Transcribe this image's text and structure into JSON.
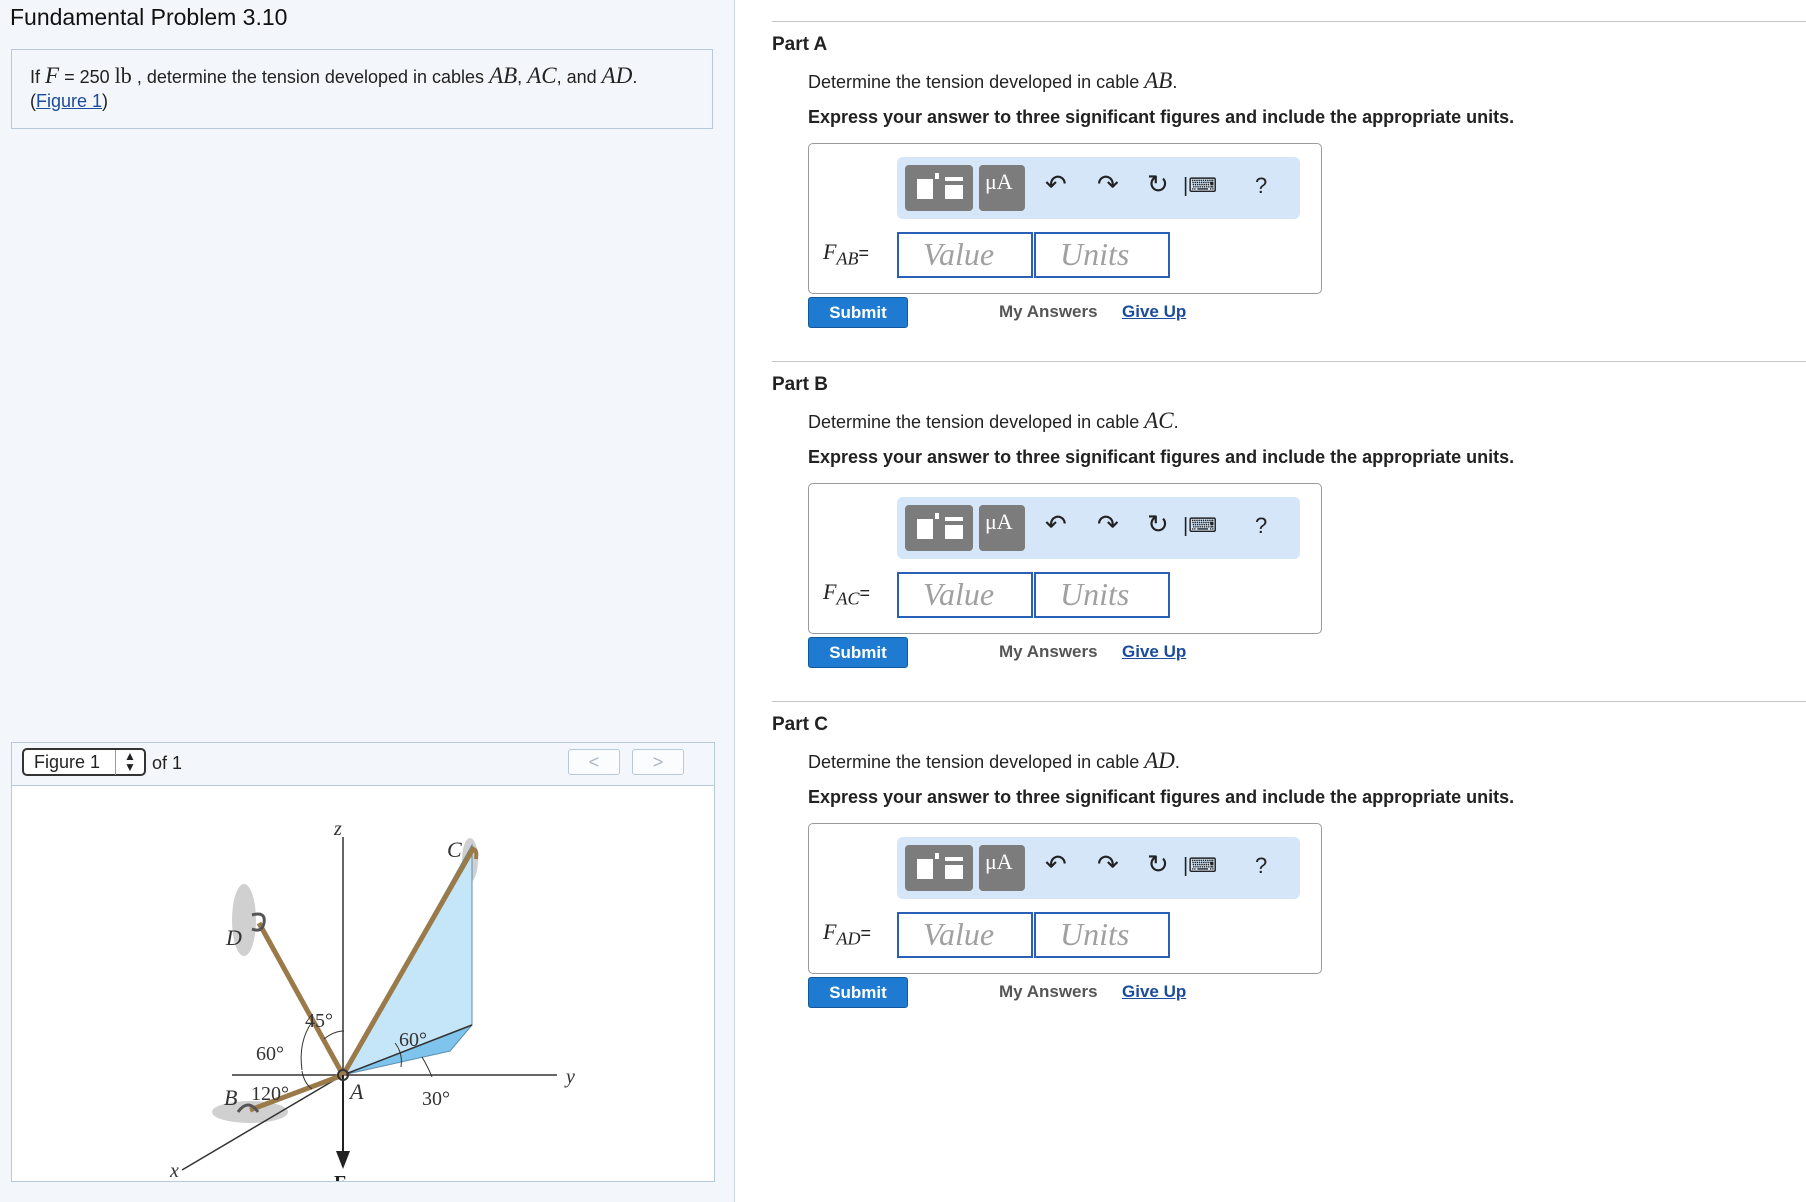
{
  "problem": {
    "title": "Fundamental Problem 3.10",
    "text_if": "If",
    "force_var": "F",
    "force_eq": "= 250",
    "force_unit": "lb",
    "text_mid": ", determine the tension developed in cables",
    "cable_ab": "AB",
    "comma": ",",
    "cable_ac": "AC",
    "text_and": ", and",
    "cable_ad": "AD",
    "period": ".",
    "figure_link_open": "(",
    "figure_link": "Figure 1",
    "figure_link_close": ")"
  },
  "figure": {
    "select_label": "Figure 1",
    "of_label": "of 1",
    "prev_label": "<",
    "next_label": ">",
    "labels": {
      "z": "z",
      "y": "y",
      "x": "x",
      "A": "A",
      "B": "B",
      "C": "C",
      "D": "D",
      "F": "F",
      "angle_45": "45°",
      "angle_60_left": "60°",
      "angle_120": "120°",
      "angle_60_right": "60°",
      "angle_30": "30°"
    }
  },
  "parts": [
    {
      "label": "Part A",
      "question_prefix": "Determine the tension developed in cable",
      "cable": "AB",
      "period": ".",
      "instruction": "Express your answer to three significant figures and include the appropriate units.",
      "var_main": "F",
      "var_sub": "AB",
      "eq": "=",
      "value_placeholder": "Value",
      "units_placeholder": "Units",
      "submit": "Submit",
      "my_answers": "My Answers",
      "give_up": "Give Up"
    },
    {
      "label": "Part B",
      "question_prefix": "Determine the tension developed in cable",
      "cable": "AC",
      "period": ".",
      "instruction": "Express your answer to three significant figures and include the appropriate units.",
      "var_main": "F",
      "var_sub": "AC",
      "eq": "=",
      "value_placeholder": "Value",
      "units_placeholder": "Units",
      "submit": "Submit",
      "my_answers": "My Answers",
      "give_up": "Give Up"
    },
    {
      "label": "Part C",
      "question_prefix": "Determine the tension developed in cable",
      "cable": "AD",
      "period": ".",
      "instruction": "Express your answer to three significant figures and include the appropriate units.",
      "var_main": "F",
      "var_sub": "AD",
      "eq": "=",
      "value_placeholder": "Value",
      "units_placeholder": "Units",
      "submit": "Submit",
      "my_answers": "My Answers",
      "give_up": "Give Up"
    }
  ],
  "toolbar": {
    "mu_label": "μA",
    "help_label": "?",
    "icons": [
      "templates-icon",
      "units-symbol-icon",
      "undo-icon",
      "redo-icon",
      "reset-icon",
      "keyboard-icon",
      "help-icon"
    ]
  },
  "colors": {
    "accent": "#1f7ad1",
    "link": "#1a4b9c",
    "toolbar_bg": "#d4e6f8",
    "input_border": "#2a5fb8",
    "figure_fill": "#c5e6f8"
  }
}
